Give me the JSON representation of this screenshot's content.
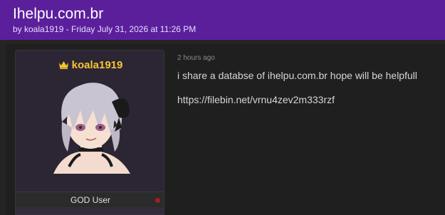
{
  "thread": {
    "title": "Ihelpu.com.br",
    "byline": "by koala1919 - Friday July 31, 2026 at 11:26 PM"
  },
  "post": {
    "time": "2 hours ago",
    "message": "i share a databse of ihelpu.com.br hope will be helpfull",
    "link": "https://filebin.net/vrnu4zev2m333rzf"
  },
  "user": {
    "name": "koala1919",
    "rank": "GOD User",
    "name_color": "#f6c531",
    "status_color": "#a31f1f"
  },
  "icons": {
    "crown": "crown-icon",
    "avatar": "anime-avatar",
    "status": "status-dot"
  }
}
